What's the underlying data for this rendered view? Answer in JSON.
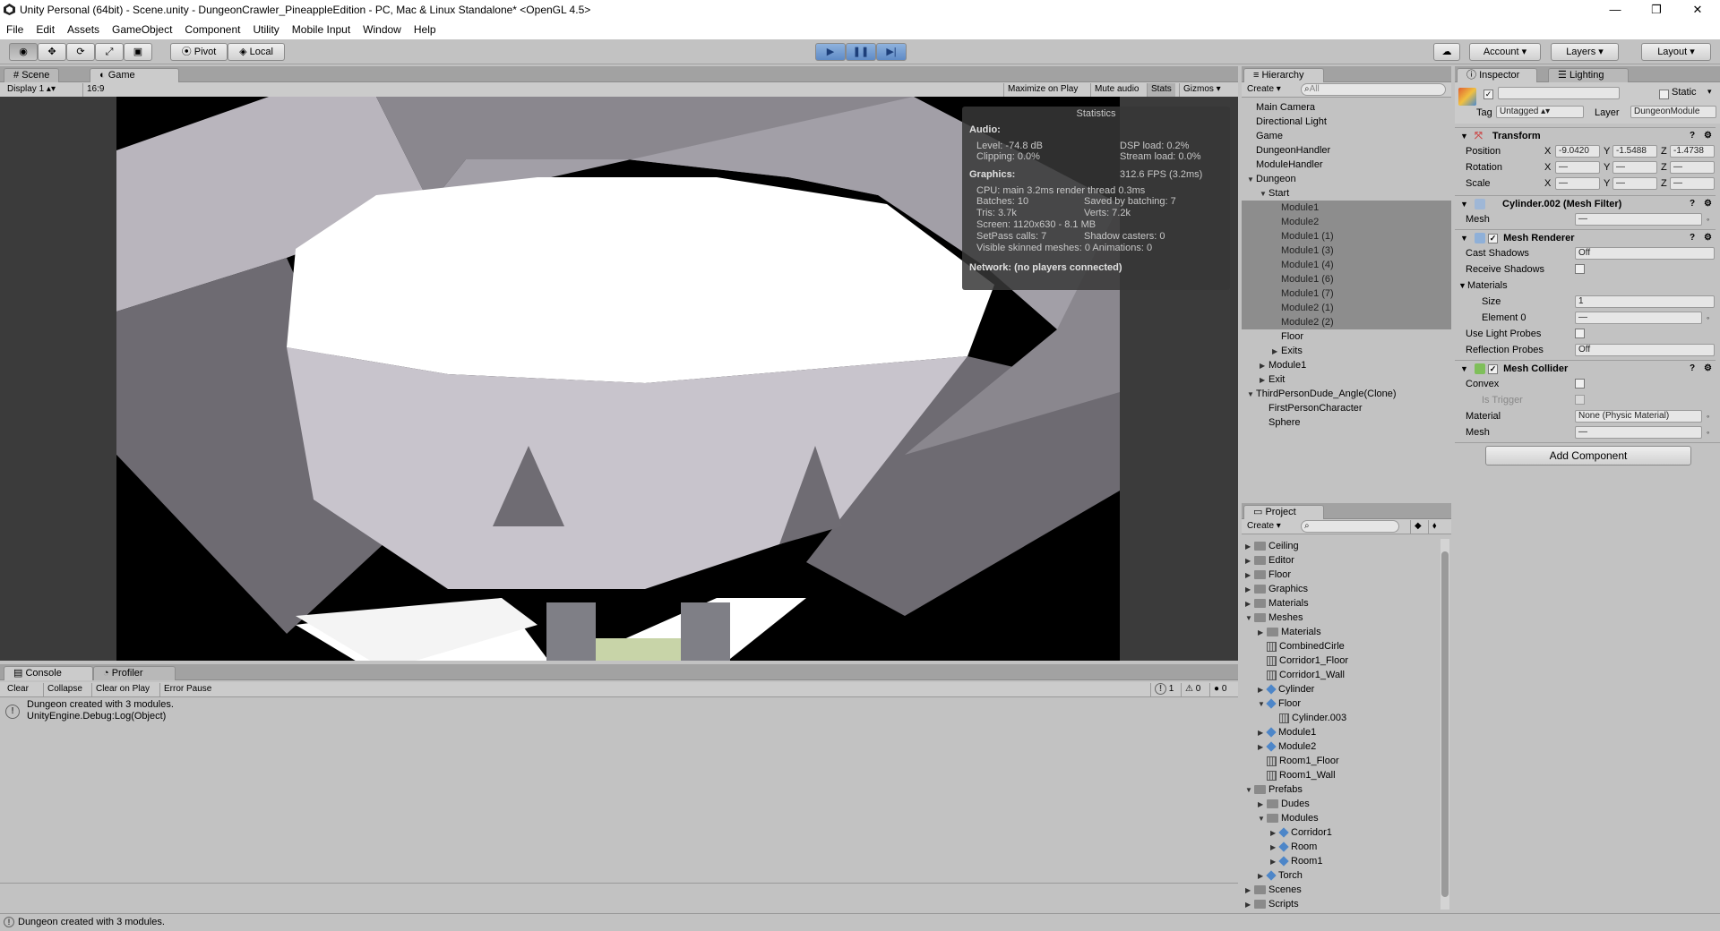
{
  "window": {
    "title": "Unity Personal (64bit) - Scene.unity - DungeonCrawler_PineappleEdition - PC, Mac & Linux Standalone* <OpenGL 4.5>",
    "minimize": "—",
    "restore": "❐",
    "close": "✕"
  },
  "menu": [
    "File",
    "Edit",
    "Assets",
    "GameObject",
    "Component",
    "Utility",
    "Mobile Input",
    "Window",
    "Help"
  ],
  "toolbar": {
    "pivot": "Pivot",
    "local": "Local",
    "account": "Account",
    "layers": "Layers",
    "layout": "Layout"
  },
  "scene_tabs": {
    "scene": "Scene",
    "game": "Game"
  },
  "game_bar": {
    "display": "Display 1",
    "aspect": "16:9",
    "maximize": "Maximize on Play",
    "mute": "Mute audio",
    "stats": "Stats",
    "gizmos": "Gizmos"
  },
  "stats": {
    "title": "Statistics",
    "audio_h": "Audio:",
    "level": "Level: -74.8 dB",
    "dsp": "DSP load: 0.2%",
    "clipping": "Clipping: 0.0%",
    "stream": "Stream load: 0.0%",
    "graphics_h": "Graphics:",
    "fps": "312.6 FPS (3.2ms)",
    "cpu": "CPU: main 3.2ms  render thread 0.3ms",
    "batches": "Batches: 10",
    "saved": "Saved by batching: 7",
    "tris": "Tris: 3.7k",
    "verts": "Verts: 7.2k",
    "screen": "Screen: 1120x630 - 8.1 MB",
    "setpass": "SetPass calls: 7",
    "shadow": "Shadow casters: 0",
    "skinned": "Visible skinned meshes: 0  Animations: 0",
    "network": "Network: (no players connected)"
  },
  "hierarchy": {
    "tab": "Hierarchy",
    "create": "Create",
    "search_placeholder": "All",
    "items": [
      {
        "label": "Main Camera",
        "indent": 0,
        "tri": "",
        "sel": false
      },
      {
        "label": "Directional Light",
        "indent": 0,
        "tri": "",
        "sel": false
      },
      {
        "label": "Game",
        "indent": 0,
        "tri": "",
        "sel": false
      },
      {
        "label": "DungeonHandler",
        "indent": 0,
        "tri": "",
        "sel": false
      },
      {
        "label": "ModuleHandler",
        "indent": 0,
        "tri": "",
        "sel": false
      },
      {
        "label": "Dungeon",
        "indent": 0,
        "tri": "▼",
        "sel": false
      },
      {
        "label": "Start",
        "indent": 1,
        "tri": "▼",
        "sel": false
      },
      {
        "label": "Module1",
        "indent": 2,
        "tri": "",
        "sel": true
      },
      {
        "label": "Module2",
        "indent": 2,
        "tri": "",
        "sel": true
      },
      {
        "label": "Module1 (1)",
        "indent": 2,
        "tri": "",
        "sel": true
      },
      {
        "label": "Module1 (3)",
        "indent": 2,
        "tri": "",
        "sel": true
      },
      {
        "label": "Module1 (4)",
        "indent": 2,
        "tri": "",
        "sel": true
      },
      {
        "label": "Module1 (6)",
        "indent": 2,
        "tri": "",
        "sel": true
      },
      {
        "label": "Module1 (7)",
        "indent": 2,
        "tri": "",
        "sel": true
      },
      {
        "label": "Module2 (1)",
        "indent": 2,
        "tri": "",
        "sel": true
      },
      {
        "label": "Module2 (2)",
        "indent": 2,
        "tri": "",
        "sel": true
      },
      {
        "label": "Floor",
        "indent": 2,
        "tri": "",
        "sel": false
      },
      {
        "label": "Exits",
        "indent": 2,
        "tri": "▶",
        "sel": false
      },
      {
        "label": "Module1",
        "indent": 1,
        "tri": "▶",
        "sel": false
      },
      {
        "label": "Exit",
        "indent": 1,
        "tri": "▶",
        "sel": false
      },
      {
        "label": "ThirdPersonDude_Angle(Clone)",
        "indent": 0,
        "tri": "▼",
        "sel": false
      },
      {
        "label": "FirstPersonCharacter",
        "indent": 1,
        "tri": "",
        "sel": false
      },
      {
        "label": "Sphere",
        "indent": 1,
        "tri": "",
        "sel": false
      }
    ]
  },
  "project": {
    "tab": "Project",
    "create": "Create",
    "items": [
      {
        "label": "Ceiling",
        "indent": 0,
        "tri": "▶",
        "icon": "folder"
      },
      {
        "label": "Editor",
        "indent": 0,
        "tri": "▶",
        "icon": "folder"
      },
      {
        "label": "Floor",
        "indent": 0,
        "tri": "▶",
        "icon": "folder"
      },
      {
        "label": "Graphics",
        "indent": 0,
        "tri": "▶",
        "icon": "folder"
      },
      {
        "label": "Materials",
        "indent": 0,
        "tri": "▶",
        "icon": "folder"
      },
      {
        "label": "Meshes",
        "indent": 0,
        "tri": "▼",
        "icon": "folder"
      },
      {
        "label": "Materials",
        "indent": 1,
        "tri": "▶",
        "icon": "folder"
      },
      {
        "label": "CombinedCirle",
        "indent": 1,
        "tri": "",
        "icon": "mesh"
      },
      {
        "label": "Corridor1_Floor",
        "indent": 1,
        "tri": "",
        "icon": "mesh"
      },
      {
        "label": "Corridor1_Wall",
        "indent": 1,
        "tri": "",
        "icon": "mesh"
      },
      {
        "label": "Cylinder",
        "indent": 1,
        "tri": "▶",
        "icon": "prefab"
      },
      {
        "label": "Floor",
        "indent": 1,
        "tri": "▼",
        "icon": "prefab"
      },
      {
        "label": "Cylinder.003",
        "indent": 2,
        "tri": "",
        "icon": "mesh"
      },
      {
        "label": "Module1",
        "indent": 1,
        "tri": "▶",
        "icon": "prefab"
      },
      {
        "label": "Module2",
        "indent": 1,
        "tri": "▶",
        "icon": "prefab"
      },
      {
        "label": "Room1_Floor",
        "indent": 1,
        "tri": "",
        "icon": "mesh"
      },
      {
        "label": "Room1_Wall",
        "indent": 1,
        "tri": "",
        "icon": "mesh"
      },
      {
        "label": "Prefabs",
        "indent": 0,
        "tri": "▼",
        "icon": "folder"
      },
      {
        "label": "Dudes",
        "indent": 1,
        "tri": "▶",
        "icon": "folder"
      },
      {
        "label": "Modules",
        "indent": 1,
        "tri": "▼",
        "icon": "folder"
      },
      {
        "label": "Corridor1",
        "indent": 2,
        "tri": "▶",
        "icon": "prefab"
      },
      {
        "label": "Room",
        "indent": 2,
        "tri": "▶",
        "icon": "prefab"
      },
      {
        "label": "Room1",
        "indent": 2,
        "tri": "▶",
        "icon": "prefab"
      },
      {
        "label": "Torch",
        "indent": 1,
        "tri": "▶",
        "icon": "prefab"
      },
      {
        "label": "Scenes",
        "indent": 0,
        "tri": "▶",
        "icon": "folder"
      },
      {
        "label": "Scripts",
        "indent": 0,
        "tri": "▶",
        "icon": "folder"
      }
    ]
  },
  "inspector": {
    "tab": "Inspector",
    "lighting_tab": "Lighting",
    "static": "Static",
    "tag_label": "Tag",
    "tag_value": "Untagged",
    "layer_label": "Layer",
    "layer_value": "DungeonModule",
    "transform": {
      "title": "Transform",
      "position": "Position",
      "rotation": "Rotation",
      "scale": "Scale",
      "px": "-9.0420",
      "py": "-1.5488",
      "pz": "-1.4738",
      "dash": "—",
      "x": "X",
      "y": "Y",
      "z": "Z"
    },
    "mesh_filter": {
      "title": "Cylinder.002 (Mesh Filter)",
      "mesh": "Mesh",
      "mesh_value": "—"
    },
    "mesh_renderer": {
      "title": "Mesh Renderer",
      "cast_shadows": "Cast Shadows",
      "cast_value": "Off",
      "receive_shadows": "Receive Shadows",
      "materials": "Materials",
      "size": "Size",
      "size_value": "1",
      "element0": "Element 0",
      "element0_value": "—",
      "light_probes": "Use Light Probes",
      "reflection": "Reflection Probes",
      "reflection_value": "Off"
    },
    "mesh_collider": {
      "title": "Mesh Collider",
      "convex": "Convex",
      "trigger": "Is Trigger",
      "material": "Material",
      "material_value": "None (Physic Material)",
      "mesh": "Mesh",
      "mesh_value": "—"
    },
    "add_component": "Add Component"
  },
  "console": {
    "tab": "Console",
    "profiler_tab": "Profiler",
    "clear": "Clear",
    "collapse": "Collapse",
    "clear_on_play": "Clear on Play",
    "error_pause": "Error Pause",
    "count_info": "1",
    "count_warn": "0",
    "count_err": "0",
    "line1": "Dungeon created with 3 modules.",
    "line2": "UnityEngine.Debug:Log(Object)"
  },
  "status": "Dungeon created with 3 modules.",
  "colors": {
    "play_blue": "#5f8bc6",
    "selection": "#8d8d8d",
    "editor_gray": "#c2c2c2"
  }
}
